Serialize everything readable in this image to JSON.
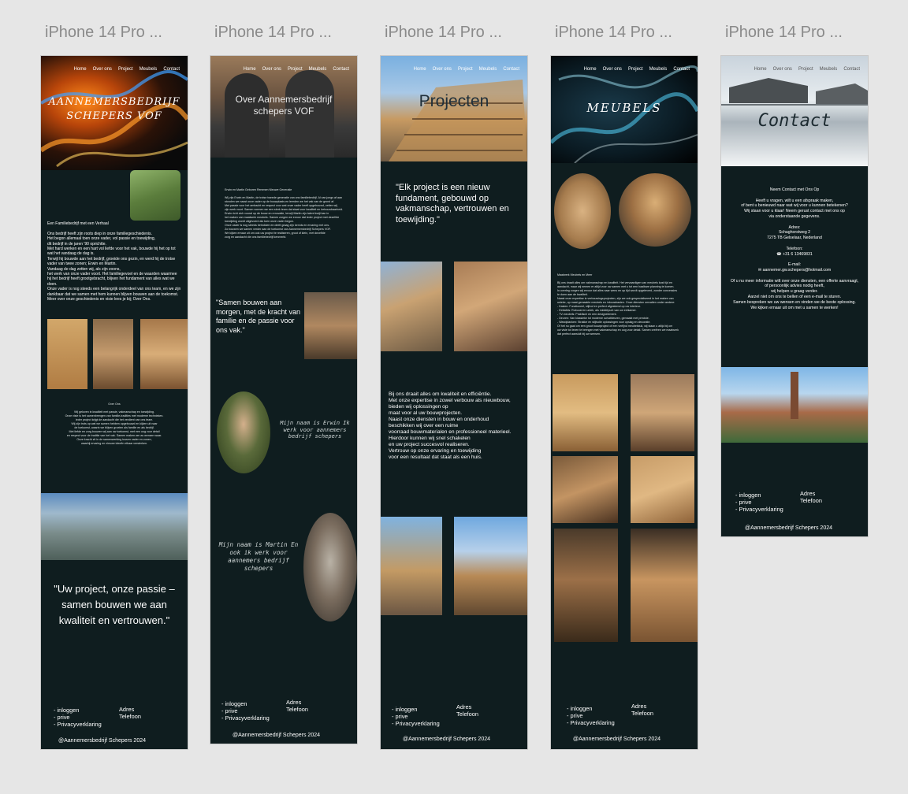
{
  "frame_titles": [
    "iPhone 14 Pro ...",
    "iPhone 14 Pro ...",
    "iPhone 14 Pro ...",
    "iPhone 14 Pro ...",
    "iPhone 14 Pro ..."
  ],
  "nav": {
    "home": "Home",
    "over_ons": "Over ons",
    "project": "Project",
    "meubels": "Meubels",
    "contact": "Contact"
  },
  "footer": {
    "inloggen": "- inloggen",
    "prive": "- prive",
    "privacy": "- Privacyverklaring",
    "adres": "Adres",
    "telefoon": "Telefoon",
    "copyright": "@Aannemersbedrijf Schepers 2024"
  },
  "home": {
    "title_line1": "AANNEMERSBEDRIJF",
    "title_line2": "SCHEPERS VOF",
    "intro_heading": "Een Familiebedrijf met een Verhaal",
    "intro_lines": [
      "Ons bedrijf heeft zijn roots diep in onze familiegeschiedenis.",
      "Het begon allemaal toen onze vader, vol passie en toewijding,",
      "dit bedrijf in de jaren '90 oprichtte.",
      "Met hard werken en een hart vol liefde voor het vak, bouwde hij het op tot",
      "wat het vandaag de dag is.",
      "Terwijl hij bouwde aan het bedrijf, groeide ons gezin, en werd hij de trotse",
      "vader van twee zonen; Erwin en Martin.",
      "",
      "Vandaag de dag zetten wij, als zijn zoons,",
      "het werk van onze vader voort. Het familiegevoel en de waarden waarmee",
      "hij het bedrijf heeft grootgebracht, blijven het fundament van alles wat we doen.",
      "Onze vader is nog steeds een belangrijk onderdeel van ons team, en we zijn",
      "dankbaar dat we samen met hem kunnen blijven bouwen aan de toekomst.",
      "",
      "Meer over onze geschiedenis en visie lees je bij; Over Ons."
    ],
    "over_heading": "Over Ons",
    "over_lines": [
      "Wij geloven in kwaliteit met passie, vakmanschap en toewijding.",
      "Onze visie is het samenbrengen van familie-tradities met moderne technieken.",
      "Ieder project krijgt de aandacht die het verdient van ons team.",
      "Wij zijn trots op wat we samen hebben opgebouwd en kijken uit naar",
      "de toekomst, waarin we blijven groeien als familie en als bedrijf.",
      "",
      "Met liefde en zorg bouwen wij aan uw toekomst, met een oog voor detail",
      "en respect voor de traditie van het vak. Samen maken we uw wensen waar.",
      "",
      "Onze kracht zit in de samenwerking tussen vader en zonen,",
      "waarbij ervaring en nieuwe ideeën elkaar versterken."
    ],
    "quote": "\"Uw project, onze passie – samen bouwen we aan kwaliteit en vertrouwen.\""
  },
  "over": {
    "title_line1": "Over Aannemersbedrijf",
    "title_line2": "schepers VOF",
    "heading": "Erwin en Martin Geboren Remmen Nieuwe Generatie",
    "body_lines": [
      "Wij zijn Erwin en Martin, de trotse tweede generatie van ons familiebedrijf. Al van jongs af aan",
      "stonden we naast onze vader op de bouwplaats en leerden we het vak van de grond af.",
      "Met passie voor het ambacht en respect voor wat onze vader heeft opgebouwd, zetten wij",
      "zijn werk voort. Samen vormen we een sterk team dat staat voor kwaliteit en betrouwbaarheid.",
      "",
      "Erwin richt zich vooral op de bouw en renovatie, terwijl Martin zijn talent kwijt kan in",
      "het maken van maatwerk meubels. Samen zorgen we ervoor dat ieder project met dezelfde",
      "toewijding wordt uitgevoerd als toen onze vader begon.",
      "",
      "Onze vader is nog steeds betrokken en deelt graag zijn kennis en ervaring met ons.",
      "Zo bouwen we samen verder aan de toekomst van Aannemersbedrijf Schepers VOF.",
      "",
      "We kijken ernaar uit om ook uw project te realiseren, groot of klein, met dezelfde",
      "zorg en aandacht die ons familiebedrijf kenmerkt."
    ],
    "quote": "\"Samen bouwen aan morgen, met de kracht van familie en de passie voor ons vak.\"",
    "erwin": "Mijn naam is Erwin Ik werk voor aannemers bedrijf schepers",
    "martin": "Mijn naam is Martin En ook ik werk voor aannemers bedrijf schepers"
  },
  "projecten": {
    "title": "Projecten",
    "quote": "\"Elk project is een nieuw fundament, gebouwd op vakmanschap, vertrouwen en toewijding.\"",
    "body_lines": [
      "Bij ons draait alles om kwaliteit en efficiëntie.",
      "Met onze expertise in zowel verbouw als nieuwbouw,",
      "bieden wij oplossingen op",
      "maat voor al uw bouwprojecten.",
      "Naast onze diensten in bouw en onderhoud",
      "beschikken wij over een ruime",
      "voorraad bouwmaterialen en professioneel materieel.",
      "Hierdoor kunnen wij snel schakelen",
      "en uw project succesvol realiseren.",
      "Vertrouw op onze ervaring en toewijding",
      "voor een resultaat dat staat als een huis."
    ]
  },
  "meubels": {
    "title": "MEUBELS",
    "heading": "Maatwerk Meubels en Meer",
    "body_lines": [
      "Bij ons draait alles om vakmanschap en kwaliteit. Het vervaardigen van meubels kost tijd en",
      "aandacht, maar wij nemen er altijd voor uw samen met u tot een haalbare planning te komen.",
      "In overleg zorgen wij ervoor dat alles naar wens en op tijd wordt opgeleverd, zonder concessies",
      "te doen aan de kwaliteit.",
      "",
      "Naast onze expertise in verbouwingsprojecten, zijn we ook gespecialiseerd in het maken van",
      "unieke, op maat gemaakte meubels en inbouwkasten. Onze diensten omvatten onder andere:",
      "",
      "- Kasten: Functioneel, stijlvol en perfect afgestemd op uw interieur.",
      "",
      "- Eettafels: Robuust en uniek, als middelpunt van uw eetkamer.",
      "",
      "- TV-meubels: Praktisch en een designelement.",
      "",
      "- Deuren: Van klassieke tot moderne schuifdeuren, gemaakt met precisie.",
      "",
      "- Wandplanken: Strakke en stijlvolle oplossingen voor opslag en decoratie.",
      "",
      "Of het nu gaat om een groot bouwproject of een verfijnd meubelstuk, wij staan u altijd bij om",
      "uw visie tot leven te brengen met vakmanschap en oog voor detail. Samen creëren we maatwerk",
      "dat perfect aansluit bij uw wensen."
    ]
  },
  "contact": {
    "title": "Contact",
    "heading": "Neem Contact met Ons Op",
    "intro_lines": [
      "Heeft u vragen, wilt u een afspraak maken,",
      "of bent u benieuwd naar wat wij voor u kunnen betekenen?",
      "Wij staan voor u klaar! Neem gerust contact met ons op",
      "via onderstaande gegevens."
    ],
    "adres_label": "Adres:",
    "adres_lines": [
      "Schaghorstweg 2",
      "7275 TB Gelselaar, Nederland"
    ],
    "telefoon_label": "Telefoon:",
    "telefoon": "+31 6 13469831",
    "email_label": "E-mail:",
    "email": "aannemer.gw.schepers@hotmail.com",
    "outro_lines": [
      "Of u nu meer informatie wilt over onze diensten, een offerte aanvraagt,",
      "of persoonlijk advies nodig heeft,",
      "wij helpen u graag verder.",
      "Aarzel niet om ons te bellen of een e-mail te sturen.",
      "Samen bespreken we uw wensen en vinden we de beste oplossing.",
      "",
      "We kijken ernaar uit om met u samen te werken!"
    ]
  }
}
